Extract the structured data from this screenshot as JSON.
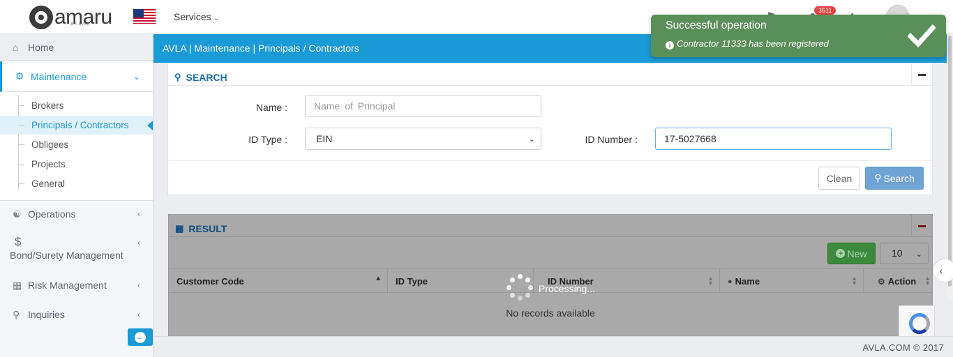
{
  "header": {
    "logo_text": "amaru",
    "logo_sub": "BY AVLA",
    "services_label": "Services",
    "notification_count": "3511"
  },
  "sidebar": {
    "home": "Home",
    "maintenance": "Maintenance",
    "submenu": [
      "Brokers",
      "Principals / Contractors",
      "Obligees",
      "Projects",
      "General"
    ],
    "operations": "Operations",
    "bond_surety": "Bond/Surety Management",
    "risk": "Risk Management",
    "inquiries": "Inquiries"
  },
  "breadcrumb": "AVLA | Maintenance | Principals / Contractors",
  "search": {
    "title": "SEARCH",
    "name_label": "Name :",
    "name_placeholder": "Name  of  Principal",
    "id_type_label": "ID Type :",
    "id_type_value": "EIN",
    "id_number_label": "ID Number :",
    "id_number_value": "17-5027668",
    "clean_label": "Clean",
    "search_label": "Search"
  },
  "result": {
    "title": "RESULT",
    "new_label": "New",
    "page_size": "10",
    "columns": [
      "Customer Code",
      "ID Type",
      "ID Number",
      "Name",
      "Action"
    ],
    "empty_text": "No records available",
    "processing_text": "Processing..."
  },
  "toast": {
    "title": "Successful operation",
    "message": "Contractor 11333 has been registered"
  },
  "footer": "AVLA.COM © 2017",
  "colors": {
    "primary": "#1a9ad6",
    "toast_bg": "#5b8f59",
    "overlay": "#a9a9a9"
  }
}
